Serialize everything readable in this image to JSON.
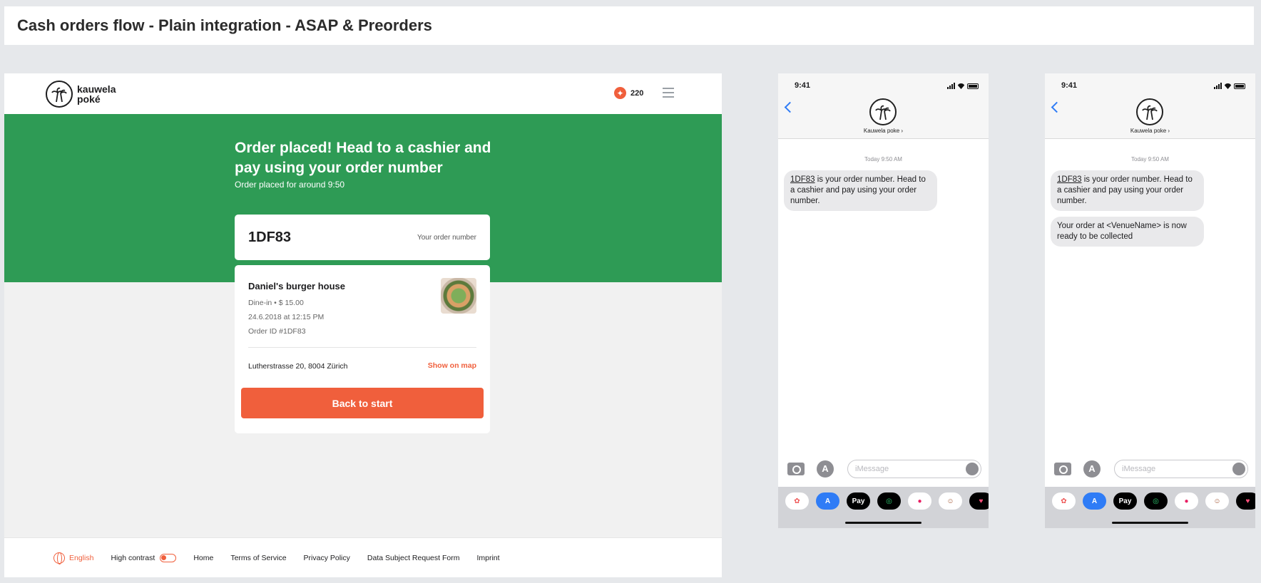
{
  "page_title": "Cash orders flow - Plain integration - ASAP & Preorders",
  "web": {
    "logo_line1": "kauwela",
    "logo_line2": "poké",
    "points": "220",
    "heading": "Order placed! Head to a cashier and pay using your order number",
    "subheading": "Order placed for around 9:50",
    "order_number": "1DF83",
    "order_number_label": "Your order number",
    "venue": "Daniel's burger house",
    "dine_info": "Dine-in • $ 15.00",
    "date": "24.6.2018 at 12:15 PM",
    "order_id": "Order ID #1DF83",
    "address": "Lutherstrasse 20, 8004 Zürich",
    "show_on_map": "Show on map",
    "back_button": "Back to start",
    "footer": {
      "language": "English",
      "high_contrast": "High contrast",
      "links": [
        "Home",
        "Terms of Service",
        "Privacy Policy",
        "Data Subject Request Form",
        "Imprint"
      ]
    }
  },
  "phones": [
    {
      "time": "9:41",
      "contact": "Kauwela poke ›",
      "timestamp": "Today 9:50 AM",
      "messages": [
        {
          "code": "1DF83",
          "text": " is your order number. Head to a cashier and pay using your order number."
        }
      ],
      "placeholder": "iMessage"
    },
    {
      "time": "9:41",
      "contact": "Kauwela poke ›",
      "timestamp": "Today 9:50 AM",
      "messages": [
        {
          "code": "1DF83",
          "text": " is your order number. Head to a cashier and pay using your order number."
        },
        {
          "code": "",
          "text": "Your order at <VenueName> is now ready to be collected"
        }
      ],
      "placeholder": "iMessage"
    }
  ],
  "tray_apps": [
    "photos-icon",
    "app-store-icon",
    "Pay",
    "activity-icon",
    "digital-touch-icon",
    "memoji-icon",
    "heart-sticker-icon"
  ],
  "colors": {
    "brand_green": "#2e9b55",
    "accent_orange": "#f05f3c",
    "ios_blue": "#2f7cf6"
  }
}
